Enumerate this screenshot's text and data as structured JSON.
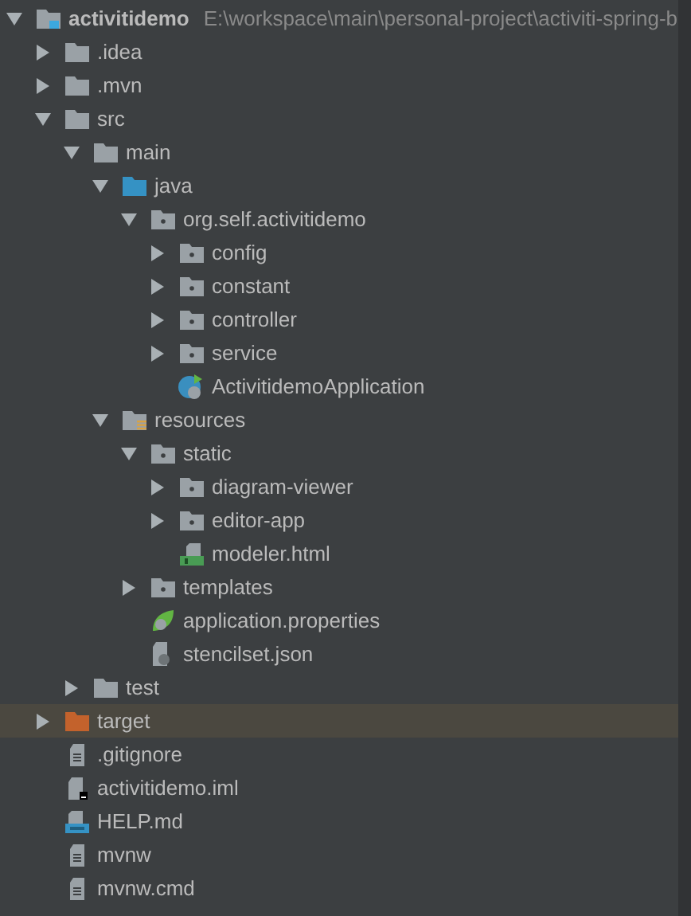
{
  "tree": [
    {
      "kind": "module",
      "label": "activitidemo",
      "path": "E:\\workspace\\main\\personal-project\\activiti-spring-b",
      "expanded": true,
      "selected": false,
      "children": [
        {
          "kind": "folder",
          "label": ".idea",
          "expanded": false,
          "selected": false
        },
        {
          "kind": "folder",
          "label": ".mvn",
          "expanded": false,
          "selected": false
        },
        {
          "kind": "folder",
          "label": "src",
          "expanded": true,
          "selected": false,
          "children": [
            {
              "kind": "folder",
              "label": "main",
              "expanded": true,
              "selected": false,
              "children": [
                {
                  "kind": "source",
                  "label": "java",
                  "expanded": true,
                  "selected": false,
                  "children": [
                    {
                      "kind": "package",
                      "label": "org.self.activitidemo",
                      "expanded": true,
                      "selected": false,
                      "children": [
                        {
                          "kind": "package",
                          "label": "config",
                          "expanded": false,
                          "selected": false
                        },
                        {
                          "kind": "package",
                          "label": "constant",
                          "expanded": false,
                          "selected": false
                        },
                        {
                          "kind": "package",
                          "label": "controller",
                          "expanded": false,
                          "selected": false
                        },
                        {
                          "kind": "package",
                          "label": "service",
                          "expanded": false,
                          "selected": false
                        },
                        {
                          "kind": "springclass",
                          "label": "ActivitidemoApplication",
                          "selected": false
                        }
                      ]
                    }
                  ]
                },
                {
                  "kind": "resources",
                  "label": "resources",
                  "expanded": true,
                  "selected": false,
                  "children": [
                    {
                      "kind": "package",
                      "label": "static",
                      "expanded": true,
                      "selected": false,
                      "children": [
                        {
                          "kind": "package",
                          "label": "diagram-viewer",
                          "expanded": false,
                          "selected": false
                        },
                        {
                          "kind": "package",
                          "label": "editor-app",
                          "expanded": false,
                          "selected": false
                        },
                        {
                          "kind": "html",
                          "label": "modeler.html",
                          "selected": false
                        }
                      ]
                    },
                    {
                      "kind": "package",
                      "label": "templates",
                      "expanded": false,
                      "selected": false
                    },
                    {
                      "kind": "spring",
                      "label": "application.properties",
                      "selected": false
                    },
                    {
                      "kind": "json",
                      "label": "stencilset.json",
                      "selected": false
                    }
                  ]
                }
              ]
            },
            {
              "kind": "folder",
              "label": "test",
              "expanded": false,
              "selected": false
            }
          ]
        },
        {
          "kind": "excluded",
          "label": "target",
          "expanded": false,
          "selected": true
        },
        {
          "kind": "text",
          "label": ".gitignore",
          "selected": false
        },
        {
          "kind": "iml",
          "label": "activitidemo.iml",
          "selected": false
        },
        {
          "kind": "md",
          "label": "HELP.md",
          "selected": false
        },
        {
          "kind": "text",
          "label": "mvnw",
          "selected": false
        },
        {
          "kind": "text",
          "label": "mvnw.cmd",
          "selected": false
        }
      ]
    }
  ]
}
